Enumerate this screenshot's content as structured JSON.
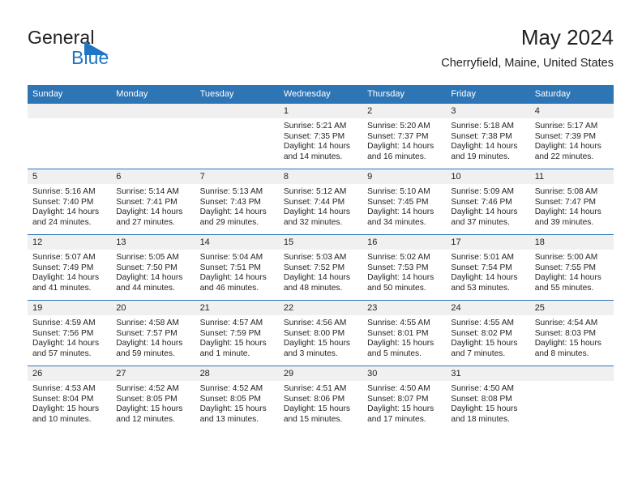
{
  "brand": {
    "name_top": "General",
    "name_bottom": "Blue",
    "flag_color": "#1f76c4",
    "top_color": "#231f20",
    "bottom_color": "#1f76c4"
  },
  "header": {
    "title": "May 2024",
    "subtitle": "Cherryfield, Maine, United States"
  },
  "theme": {
    "header_bg": "#2e75b6",
    "header_text": "#ffffff",
    "daynum_band_bg": "#f0f0f0",
    "body_text": "#231f20",
    "page_bg": "#ffffff"
  },
  "weekdays": [
    "Sunday",
    "Monday",
    "Tuesday",
    "Wednesday",
    "Thursday",
    "Friday",
    "Saturday"
  ],
  "labels": {
    "sunrise_prefix": "Sunrise:",
    "sunset_prefix": "Sunset:",
    "daylight_prefix": "Daylight:"
  },
  "weeks": [
    [
      {
        "empty": true
      },
      {
        "empty": true
      },
      {
        "empty": true
      },
      {
        "empty": false,
        "day": "1",
        "sunrise": "Sunrise: 5:21 AM",
        "sunset": "Sunset: 7:35 PM",
        "daylight": "Daylight: 14 hours and 14 minutes."
      },
      {
        "empty": false,
        "day": "2",
        "sunrise": "Sunrise: 5:20 AM",
        "sunset": "Sunset: 7:37 PM",
        "daylight": "Daylight: 14 hours and 16 minutes."
      },
      {
        "empty": false,
        "day": "3",
        "sunrise": "Sunrise: 5:18 AM",
        "sunset": "Sunset: 7:38 PM",
        "daylight": "Daylight: 14 hours and 19 minutes."
      },
      {
        "empty": false,
        "day": "4",
        "sunrise": "Sunrise: 5:17 AM",
        "sunset": "Sunset: 7:39 PM",
        "daylight": "Daylight: 14 hours and 22 minutes."
      }
    ],
    [
      {
        "empty": false,
        "day": "5",
        "sunrise": "Sunrise: 5:16 AM",
        "sunset": "Sunset: 7:40 PM",
        "daylight": "Daylight: 14 hours and 24 minutes."
      },
      {
        "empty": false,
        "day": "6",
        "sunrise": "Sunrise: 5:14 AM",
        "sunset": "Sunset: 7:41 PM",
        "daylight": "Daylight: 14 hours and 27 minutes."
      },
      {
        "empty": false,
        "day": "7",
        "sunrise": "Sunrise: 5:13 AM",
        "sunset": "Sunset: 7:43 PM",
        "daylight": "Daylight: 14 hours and 29 minutes."
      },
      {
        "empty": false,
        "day": "8",
        "sunrise": "Sunrise: 5:12 AM",
        "sunset": "Sunset: 7:44 PM",
        "daylight": "Daylight: 14 hours and 32 minutes."
      },
      {
        "empty": false,
        "day": "9",
        "sunrise": "Sunrise: 5:10 AM",
        "sunset": "Sunset: 7:45 PM",
        "daylight": "Daylight: 14 hours and 34 minutes."
      },
      {
        "empty": false,
        "day": "10",
        "sunrise": "Sunrise: 5:09 AM",
        "sunset": "Sunset: 7:46 PM",
        "daylight": "Daylight: 14 hours and 37 minutes."
      },
      {
        "empty": false,
        "day": "11",
        "sunrise": "Sunrise: 5:08 AM",
        "sunset": "Sunset: 7:47 PM",
        "daylight": "Daylight: 14 hours and 39 minutes."
      }
    ],
    [
      {
        "empty": false,
        "day": "12",
        "sunrise": "Sunrise: 5:07 AM",
        "sunset": "Sunset: 7:49 PM",
        "daylight": "Daylight: 14 hours and 41 minutes."
      },
      {
        "empty": false,
        "day": "13",
        "sunrise": "Sunrise: 5:05 AM",
        "sunset": "Sunset: 7:50 PM",
        "daylight": "Daylight: 14 hours and 44 minutes."
      },
      {
        "empty": false,
        "day": "14",
        "sunrise": "Sunrise: 5:04 AM",
        "sunset": "Sunset: 7:51 PM",
        "daylight": "Daylight: 14 hours and 46 minutes."
      },
      {
        "empty": false,
        "day": "15",
        "sunrise": "Sunrise: 5:03 AM",
        "sunset": "Sunset: 7:52 PM",
        "daylight": "Daylight: 14 hours and 48 minutes."
      },
      {
        "empty": false,
        "day": "16",
        "sunrise": "Sunrise: 5:02 AM",
        "sunset": "Sunset: 7:53 PM",
        "daylight": "Daylight: 14 hours and 50 minutes."
      },
      {
        "empty": false,
        "day": "17",
        "sunrise": "Sunrise: 5:01 AM",
        "sunset": "Sunset: 7:54 PM",
        "daylight": "Daylight: 14 hours and 53 minutes."
      },
      {
        "empty": false,
        "day": "18",
        "sunrise": "Sunrise: 5:00 AM",
        "sunset": "Sunset: 7:55 PM",
        "daylight": "Daylight: 14 hours and 55 minutes."
      }
    ],
    [
      {
        "empty": false,
        "day": "19",
        "sunrise": "Sunrise: 4:59 AM",
        "sunset": "Sunset: 7:56 PM",
        "daylight": "Daylight: 14 hours and 57 minutes."
      },
      {
        "empty": false,
        "day": "20",
        "sunrise": "Sunrise: 4:58 AM",
        "sunset": "Sunset: 7:57 PM",
        "daylight": "Daylight: 14 hours and 59 minutes."
      },
      {
        "empty": false,
        "day": "21",
        "sunrise": "Sunrise: 4:57 AM",
        "sunset": "Sunset: 7:59 PM",
        "daylight": "Daylight: 15 hours and 1 minute."
      },
      {
        "empty": false,
        "day": "22",
        "sunrise": "Sunrise: 4:56 AM",
        "sunset": "Sunset: 8:00 PM",
        "daylight": "Daylight: 15 hours and 3 minutes."
      },
      {
        "empty": false,
        "day": "23",
        "sunrise": "Sunrise: 4:55 AM",
        "sunset": "Sunset: 8:01 PM",
        "daylight": "Daylight: 15 hours and 5 minutes."
      },
      {
        "empty": false,
        "day": "24",
        "sunrise": "Sunrise: 4:55 AM",
        "sunset": "Sunset: 8:02 PM",
        "daylight": "Daylight: 15 hours and 7 minutes."
      },
      {
        "empty": false,
        "day": "25",
        "sunrise": "Sunrise: 4:54 AM",
        "sunset": "Sunset: 8:03 PM",
        "daylight": "Daylight: 15 hours and 8 minutes."
      }
    ],
    [
      {
        "empty": false,
        "day": "26",
        "sunrise": "Sunrise: 4:53 AM",
        "sunset": "Sunset: 8:04 PM",
        "daylight": "Daylight: 15 hours and 10 minutes."
      },
      {
        "empty": false,
        "day": "27",
        "sunrise": "Sunrise: 4:52 AM",
        "sunset": "Sunset: 8:05 PM",
        "daylight": "Daylight: 15 hours and 12 minutes."
      },
      {
        "empty": false,
        "day": "28",
        "sunrise": "Sunrise: 4:52 AM",
        "sunset": "Sunset: 8:05 PM",
        "daylight": "Daylight: 15 hours and 13 minutes."
      },
      {
        "empty": false,
        "day": "29",
        "sunrise": "Sunrise: 4:51 AM",
        "sunset": "Sunset: 8:06 PM",
        "daylight": "Daylight: 15 hours and 15 minutes."
      },
      {
        "empty": false,
        "day": "30",
        "sunrise": "Sunrise: 4:50 AM",
        "sunset": "Sunset: 8:07 PM",
        "daylight": "Daylight: 15 hours and 17 minutes."
      },
      {
        "empty": false,
        "day": "31",
        "sunrise": "Sunrise: 4:50 AM",
        "sunset": "Sunset: 8:08 PM",
        "daylight": "Daylight: 15 hours and 18 minutes."
      },
      {
        "empty": true
      }
    ]
  ]
}
